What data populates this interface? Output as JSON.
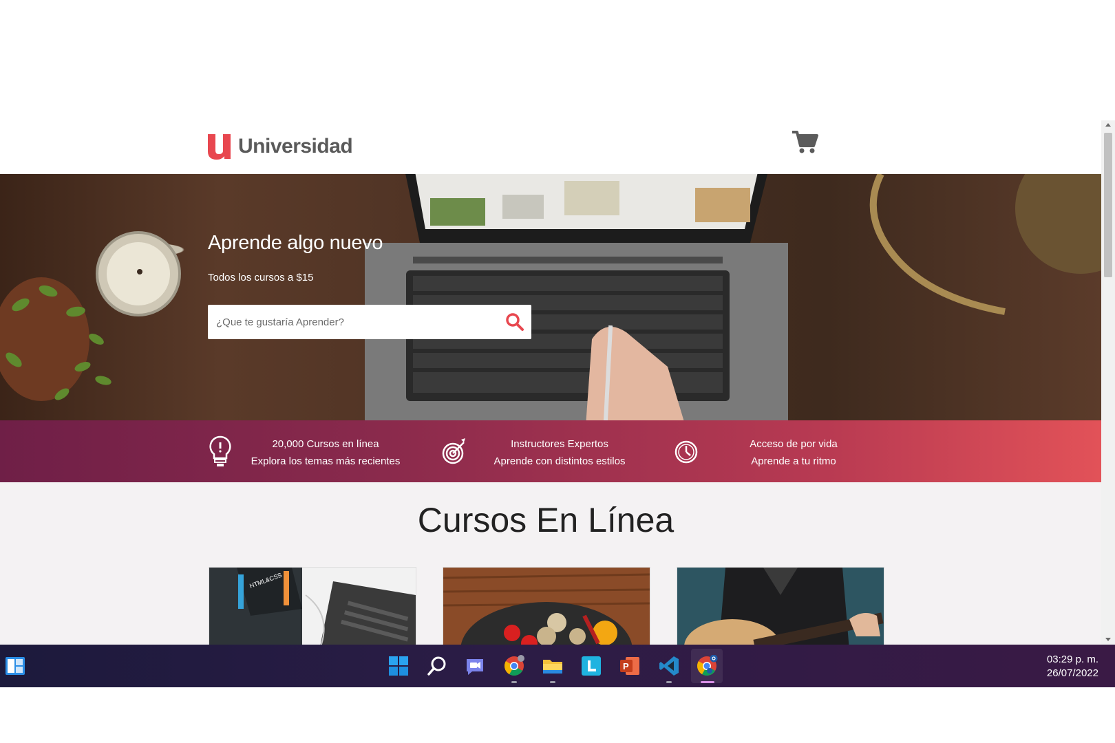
{
  "site": {
    "logo_text": "Universidad"
  },
  "hero": {
    "title": "Aprende algo nuevo",
    "subtitle": "Todos los cursos a $15",
    "search_placeholder": "¿Que te gustaría Aprender?"
  },
  "features": [
    {
      "icon": "lightbulb-icon",
      "line1": "20,000 Cursos en línea",
      "line2": "Explora los temas más recientes"
    },
    {
      "icon": "target-icon",
      "line1": "Instructores Expertos",
      "line2": "Aprende con distintos estilos"
    },
    {
      "icon": "clock-icon",
      "line1": "Acceso de por vida",
      "line2": "Aprende a tu ritmo"
    }
  ],
  "courses": {
    "title": "Cursos En Línea",
    "cards": [
      {
        "image": "html-css-book-laptop"
      },
      {
        "image": "vegetables-pan"
      },
      {
        "image": "guitar-player"
      }
    ]
  },
  "taskbar": {
    "apps": [
      "widgets-icon",
      "windows-start-icon",
      "search-icon",
      "teams-chat-icon",
      "chrome-icon",
      "file-explorer-icon",
      "l-app-icon",
      "powerpoint-icon",
      "vscode-icon",
      "chrome-profile-icon"
    ],
    "time": "03:29 p. m.",
    "date": "26/07/2022"
  },
  "colors": {
    "brand_red": "#e8474f",
    "feature_gradient_start": "#6f1f47",
    "feature_gradient_end": "#e25258",
    "taskbar": "#22193f"
  }
}
